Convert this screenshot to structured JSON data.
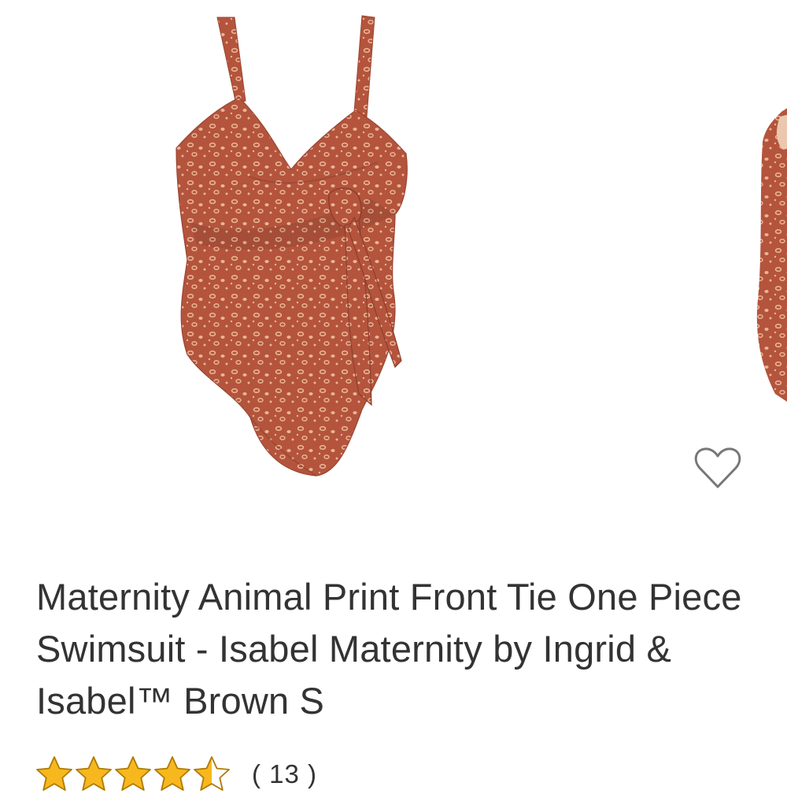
{
  "product": {
    "title": "Maternity Animal Print Front Tie One Piece Swimsuit - Isabel Maternity by Ingrid & Isabel™ Brown S",
    "rating": 4.5,
    "rating_max": 5,
    "review_count_label": "( 13 )"
  },
  "colors": {
    "swimsuit": "#B4543C",
    "print_spots": "#E9B497",
    "star_fill": "#F7B81E",
    "star_stroke": "#B07A00",
    "heart_stroke": "#777777"
  },
  "icons": {
    "favorite": "heart-outline-icon",
    "rating": "star-icon"
  }
}
